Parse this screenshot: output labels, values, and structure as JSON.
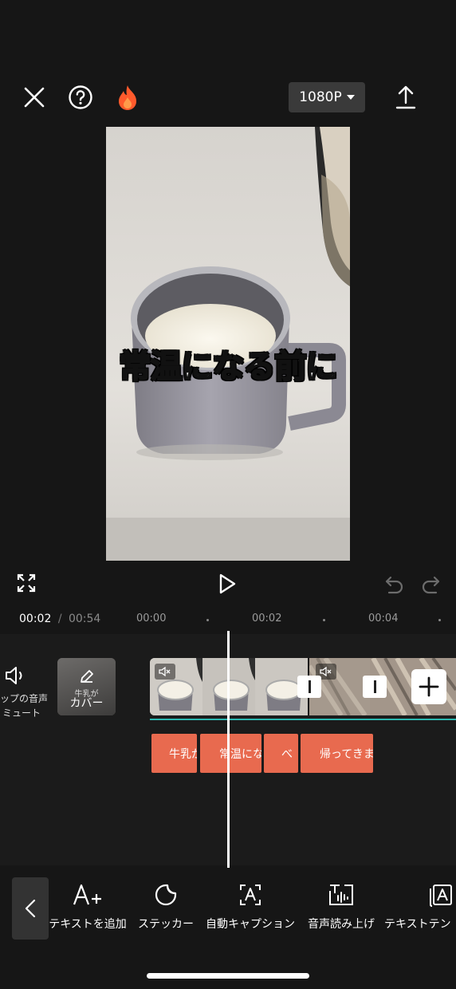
{
  "topbar": {
    "close_icon": "close-icon",
    "help_icon": "help-icon",
    "fire_icon": "fire-icon",
    "resolution_label": "1080P",
    "export_icon": "export-icon"
  },
  "preview": {
    "caption": "常温になる前に"
  },
  "playback": {
    "current_time": "00:02",
    "separator": "/",
    "total_time": "00:54",
    "ticks": [
      "00:00",
      "00:02",
      "00:04"
    ]
  },
  "timeline": {
    "mute_label_line1": "ップの音声",
    "mute_label_line2": "ミュート",
    "cover_small_text": "牛乳が",
    "cover_label": "カバー",
    "text_clips": [
      "牛乳が",
      "常温にな",
      "べ",
      "帰ってきま"
    ]
  },
  "toolbar": {
    "items": [
      {
        "label": "テキストを追加",
        "icon": "add-text-icon"
      },
      {
        "label": "ステッカー",
        "icon": "sticker-icon"
      },
      {
        "label": "自動キャプション",
        "icon": "auto-caption-icon"
      },
      {
        "label": "音声読み上げ",
        "icon": "text-to-speech-icon"
      },
      {
        "label": "テキストテン",
        "icon": "text-template-icon"
      }
    ]
  },
  "colors": {
    "accent_text_clip": "#e86a4f",
    "fire": "#ff5a2c"
  }
}
